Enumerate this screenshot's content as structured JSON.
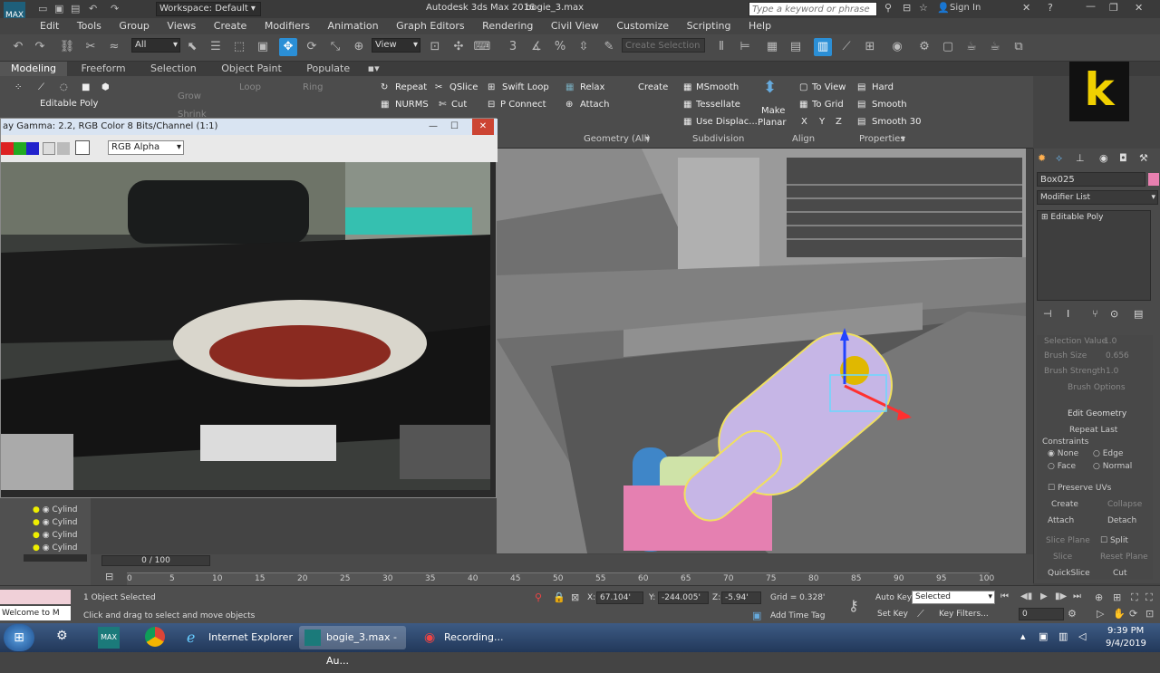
{
  "titlebar": {
    "app_title": "Autodesk 3ds Max 2016",
    "file_name": "bogie_3.max",
    "workspace": "Workspace: Default",
    "search_placeholder": "Type a keyword or phrase",
    "sign_in": "Sign In"
  },
  "menu": [
    "Edit",
    "Tools",
    "Group",
    "Views",
    "Create",
    "Modifiers",
    "Animation",
    "Graph Editors",
    "Rendering",
    "Customize",
    "Scripting",
    "Help"
  ],
  "menu_civil": "Civil View",
  "toolbar": {
    "selection_filter": "All",
    "view_dropdown": "View",
    "selection_set_placeholder": "Create Selection Se"
  },
  "ribbon_tabs": [
    "Modeling",
    "Freeform",
    "Selection",
    "Object Paint",
    "Populate"
  ],
  "ribbon": {
    "editable_poly": "Editable Poly",
    "grow": "Grow",
    "shrink": "Shrink",
    "loop": "Loop",
    "ring": "Ring",
    "repeat": "Repeat",
    "qslice": "QSlice",
    "swift_loop": "Swift Loop",
    "nurms": "NURMS",
    "cut": "Cut",
    "p_connect": "P Connect",
    "relax": "Relax",
    "create": "Create",
    "attach": "Attach",
    "msmooth": "MSmooth",
    "tessellate": "Tessellate",
    "use_displac": "Use Displac...",
    "make_planar_1": "Make",
    "make_planar_2": "Planar",
    "to_view": "To View",
    "to_grid": "To Grid",
    "x": "X",
    "y": "Y",
    "z": "Z",
    "hard": "Hard",
    "smooth": "Smooth",
    "smooth30": "Smooth 30",
    "group_geometry": "Geometry (All)",
    "group_subdivision": "Subdivision",
    "group_align": "Align",
    "group_properties": "Properties"
  },
  "photo_window": {
    "title": "ay Gamma: 2.2, RGB Color 8 Bits/Channel (1:1)",
    "channel": "RGB Alpha"
  },
  "command_panel": {
    "object_name": "Box025",
    "modifier_list": "Modifier List",
    "stack_item": "Editable Poly",
    "selection_value": "Selection Value",
    "selection_value_num": "1.0",
    "brush_size": "Brush Size",
    "brush_size_val": "0.656",
    "brush_strength": "Brush Strength",
    "brush_strength_val": "1.0",
    "brush_options": "Brush Options",
    "edit_geometry": "Edit Geometry",
    "repeat_last": "Repeat Last",
    "constraints": "Constraints",
    "none": "None",
    "edge": "Edge",
    "face": "Face",
    "normal": "Normal",
    "preserve_uvs": "Preserve UVs",
    "create": "Create",
    "collapse": "Collapse",
    "attach": "Attach",
    "detach": "Detach",
    "slice_plane": "Slice Plane",
    "split": "Split",
    "slice": "Slice",
    "reset_plane": "Reset Plane",
    "quickslice": "QuickSlice",
    "cut": "Cut"
  },
  "scene_list": [
    "Cylind",
    "Cylind",
    "Cylind",
    "Cylind"
  ],
  "timeline": {
    "frame": "0 / 100",
    "ticks": [
      "0",
      "5",
      "10",
      "15",
      "20",
      "25",
      "30",
      "35",
      "40",
      "45",
      "50",
      "55",
      "60",
      "65",
      "70",
      "75",
      "80",
      "85",
      "90",
      "95",
      "100"
    ]
  },
  "status": {
    "maxscript": "Welcome to M",
    "selected": "1 Object Selected",
    "prompt": "Click and drag to select and move objects",
    "x_label": "X:",
    "x_val": "67.104'",
    "y_label": "Y:",
    "y_val": "-244.005'",
    "z_label": "Z:",
    "z_val": "-5.94'",
    "grid": "Grid = 0.328'",
    "add_time_tag": "Add Time Tag",
    "auto_key": "Auto Key",
    "set_key": "Set Key",
    "key_mode": "Selected",
    "key_filters": "Key Filters...",
    "current_frame": "0"
  },
  "taskbar": {
    "ie": "Internet Explorer",
    "max": "bogie_3.max - Au...",
    "rec": "Recording...",
    "time": "9:39 PM",
    "date": "9/4/2019"
  },
  "colors": {
    "accent": "#2b8fd6",
    "selection": "#f0e060",
    "pink": "#e880b0",
    "lavender": "#c6b6e6"
  }
}
